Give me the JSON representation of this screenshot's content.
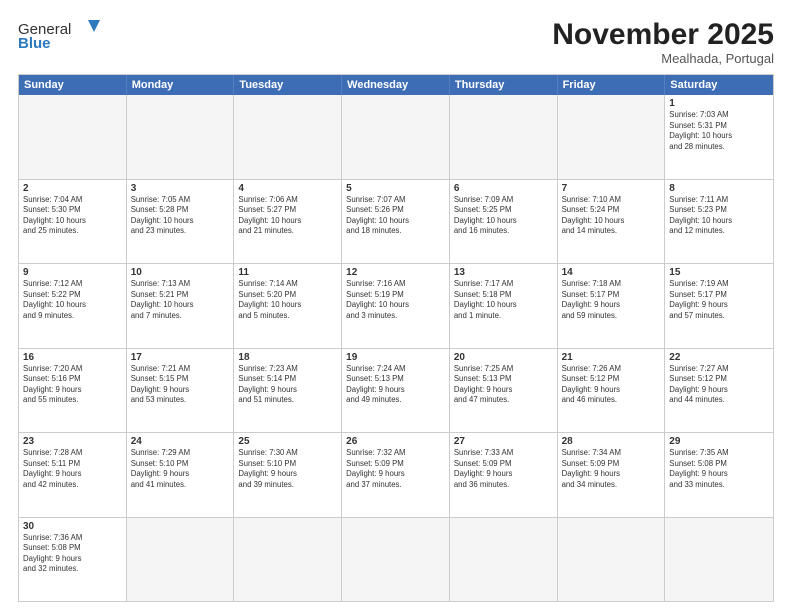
{
  "header": {
    "logo_general": "General",
    "logo_blue": "Blue",
    "month_year": "November 2025",
    "location": "Mealhada, Portugal"
  },
  "days_of_week": [
    "Sunday",
    "Monday",
    "Tuesday",
    "Wednesday",
    "Thursday",
    "Friday",
    "Saturday"
  ],
  "weeks": [
    [
      {
        "day": "",
        "info": ""
      },
      {
        "day": "",
        "info": ""
      },
      {
        "day": "",
        "info": ""
      },
      {
        "day": "",
        "info": ""
      },
      {
        "day": "",
        "info": ""
      },
      {
        "day": "",
        "info": ""
      },
      {
        "day": "1",
        "info": "Sunrise: 7:03 AM\nSunset: 5:31 PM\nDaylight: 10 hours\nand 28 minutes."
      }
    ],
    [
      {
        "day": "2",
        "info": "Sunrise: 7:04 AM\nSunset: 5:30 PM\nDaylight: 10 hours\nand 25 minutes."
      },
      {
        "day": "3",
        "info": "Sunrise: 7:05 AM\nSunset: 5:28 PM\nDaylight: 10 hours\nand 23 minutes."
      },
      {
        "day": "4",
        "info": "Sunrise: 7:06 AM\nSunset: 5:27 PM\nDaylight: 10 hours\nand 21 minutes."
      },
      {
        "day": "5",
        "info": "Sunrise: 7:07 AM\nSunset: 5:26 PM\nDaylight: 10 hours\nand 18 minutes."
      },
      {
        "day": "6",
        "info": "Sunrise: 7:09 AM\nSunset: 5:25 PM\nDaylight: 10 hours\nand 16 minutes."
      },
      {
        "day": "7",
        "info": "Sunrise: 7:10 AM\nSunset: 5:24 PM\nDaylight: 10 hours\nand 14 minutes."
      },
      {
        "day": "8",
        "info": "Sunrise: 7:11 AM\nSunset: 5:23 PM\nDaylight: 10 hours\nand 12 minutes."
      }
    ],
    [
      {
        "day": "9",
        "info": "Sunrise: 7:12 AM\nSunset: 5:22 PM\nDaylight: 10 hours\nand 9 minutes."
      },
      {
        "day": "10",
        "info": "Sunrise: 7:13 AM\nSunset: 5:21 PM\nDaylight: 10 hours\nand 7 minutes."
      },
      {
        "day": "11",
        "info": "Sunrise: 7:14 AM\nSunset: 5:20 PM\nDaylight: 10 hours\nand 5 minutes."
      },
      {
        "day": "12",
        "info": "Sunrise: 7:16 AM\nSunset: 5:19 PM\nDaylight: 10 hours\nand 3 minutes."
      },
      {
        "day": "13",
        "info": "Sunrise: 7:17 AM\nSunset: 5:18 PM\nDaylight: 10 hours\nand 1 minute."
      },
      {
        "day": "14",
        "info": "Sunrise: 7:18 AM\nSunset: 5:17 PM\nDaylight: 9 hours\nand 59 minutes."
      },
      {
        "day": "15",
        "info": "Sunrise: 7:19 AM\nSunset: 5:17 PM\nDaylight: 9 hours\nand 57 minutes."
      }
    ],
    [
      {
        "day": "16",
        "info": "Sunrise: 7:20 AM\nSunset: 5:16 PM\nDaylight: 9 hours\nand 55 minutes."
      },
      {
        "day": "17",
        "info": "Sunrise: 7:21 AM\nSunset: 5:15 PM\nDaylight: 9 hours\nand 53 minutes."
      },
      {
        "day": "18",
        "info": "Sunrise: 7:23 AM\nSunset: 5:14 PM\nDaylight: 9 hours\nand 51 minutes."
      },
      {
        "day": "19",
        "info": "Sunrise: 7:24 AM\nSunset: 5:13 PM\nDaylight: 9 hours\nand 49 minutes."
      },
      {
        "day": "20",
        "info": "Sunrise: 7:25 AM\nSunset: 5:13 PM\nDaylight: 9 hours\nand 47 minutes."
      },
      {
        "day": "21",
        "info": "Sunrise: 7:26 AM\nSunset: 5:12 PM\nDaylight: 9 hours\nand 46 minutes."
      },
      {
        "day": "22",
        "info": "Sunrise: 7:27 AM\nSunset: 5:12 PM\nDaylight: 9 hours\nand 44 minutes."
      }
    ],
    [
      {
        "day": "23",
        "info": "Sunrise: 7:28 AM\nSunset: 5:11 PM\nDaylight: 9 hours\nand 42 minutes."
      },
      {
        "day": "24",
        "info": "Sunrise: 7:29 AM\nSunset: 5:10 PM\nDaylight: 9 hours\nand 41 minutes."
      },
      {
        "day": "25",
        "info": "Sunrise: 7:30 AM\nSunset: 5:10 PM\nDaylight: 9 hours\nand 39 minutes."
      },
      {
        "day": "26",
        "info": "Sunrise: 7:32 AM\nSunset: 5:09 PM\nDaylight: 9 hours\nand 37 minutes."
      },
      {
        "day": "27",
        "info": "Sunrise: 7:33 AM\nSunset: 5:09 PM\nDaylight: 9 hours\nand 36 minutes."
      },
      {
        "day": "28",
        "info": "Sunrise: 7:34 AM\nSunset: 5:09 PM\nDaylight: 9 hours\nand 34 minutes."
      },
      {
        "day": "29",
        "info": "Sunrise: 7:35 AM\nSunset: 5:08 PM\nDaylight: 9 hours\nand 33 minutes."
      }
    ],
    [
      {
        "day": "30",
        "info": "Sunrise: 7:36 AM\nSunset: 5:08 PM\nDaylight: 9 hours\nand 32 minutes."
      },
      {
        "day": "",
        "info": ""
      },
      {
        "day": "",
        "info": ""
      },
      {
        "day": "",
        "info": ""
      },
      {
        "day": "",
        "info": ""
      },
      {
        "day": "",
        "info": ""
      },
      {
        "day": "",
        "info": ""
      }
    ]
  ]
}
